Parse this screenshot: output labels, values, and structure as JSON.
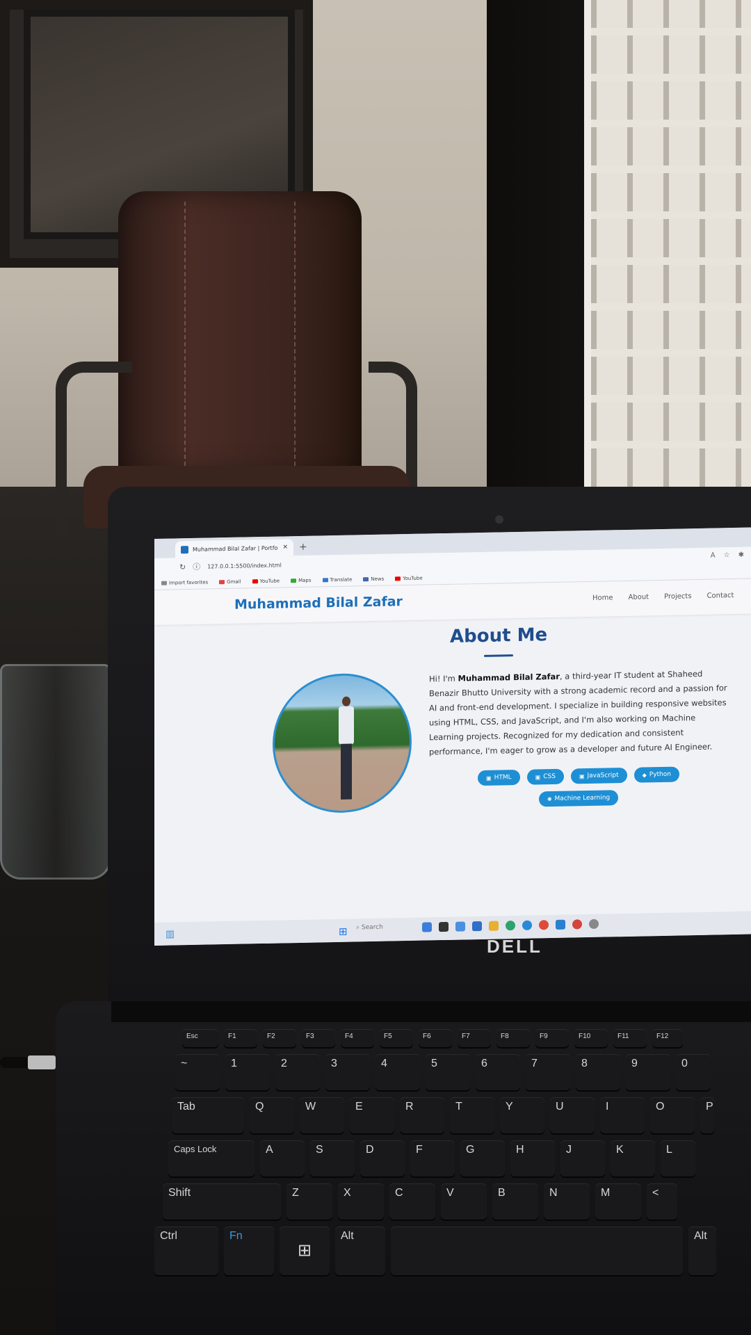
{
  "browser": {
    "tab_title": "Muhammad Bilal Zafar | Portfolio",
    "url": "127.0.0.1:5500/index.html",
    "bookmarks": [
      "Import favorites",
      "Gmail",
      "YouTube",
      "Maps",
      "Translate",
      "News",
      "YouTube"
    ]
  },
  "site": {
    "brand": "Muhammad Bilal Zafar",
    "nav": [
      "Home",
      "About",
      "Projects",
      "Contact"
    ],
    "section_title": "About Me",
    "bio_prefix": "Hi! I'm ",
    "bio_name": "Muhammad Bilal Zafar",
    "bio_rest": ", a third-year IT student at Shaheed Benazir Bhutto University with a strong academic record and a passion for AI and front-end development. I specialize in building responsive websites using HTML, CSS, and JavaScript, and I'm also working on Machine Learning projects. Recognized for my dedication and consistent performance, I'm eager to grow as a developer and future AI Engineer.",
    "skills": [
      "HTML",
      "CSS",
      "JavaScript",
      "Python",
      "Machine Learning"
    ],
    "accent_color": "#1e8fd4",
    "brand_color": "#1e6fb8"
  },
  "taskbar": {
    "search_placeholder": "Search"
  },
  "laptop": {
    "brand": "DELL"
  },
  "keyboard": {
    "fn_row": [
      "Esc",
      "F1",
      "F2",
      "F3",
      "F4",
      "F5",
      "F6",
      "F7",
      "F8",
      "F9",
      "F10",
      "F11",
      "F12"
    ],
    "number_row": [
      "~",
      "1",
      "2",
      "3",
      "4",
      "5",
      "6",
      "7",
      "8",
      "9",
      "0"
    ],
    "top_row": [
      "Tab",
      "Q",
      "W",
      "E",
      "R",
      "T",
      "Y",
      "U",
      "I",
      "O",
      "P"
    ],
    "home_row": [
      "Caps Lock",
      "A",
      "S",
      "D",
      "F",
      "G",
      "H",
      "J",
      "K",
      "L"
    ],
    "bottom_row": [
      "Shift",
      "Z",
      "X",
      "C",
      "V",
      "B",
      "N",
      "M",
      "<"
    ],
    "space_row": [
      "Ctrl",
      "Fn",
      "",
      "Alt",
      "",
      "Alt"
    ]
  }
}
